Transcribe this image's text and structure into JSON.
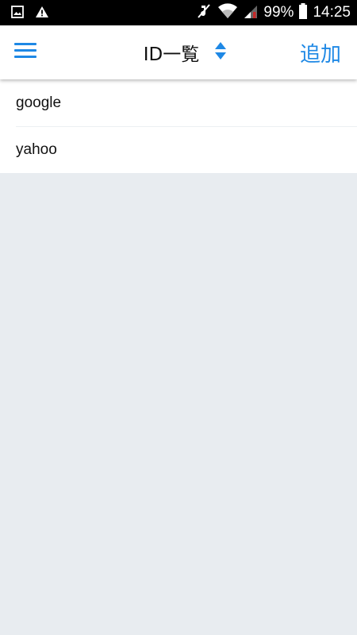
{
  "status_bar": {
    "icons_left": [
      "image-icon",
      "warning-icon"
    ],
    "icons_right": [
      "mute-icon",
      "wifi-icon",
      "signal-icon"
    ],
    "battery_percent": "99%",
    "time": "14:25"
  },
  "header": {
    "title": "ID一覧",
    "add_label": "追加",
    "accent_color": "#1e88e5"
  },
  "list": {
    "items": [
      {
        "label": "google"
      },
      {
        "label": "yahoo"
      }
    ]
  }
}
